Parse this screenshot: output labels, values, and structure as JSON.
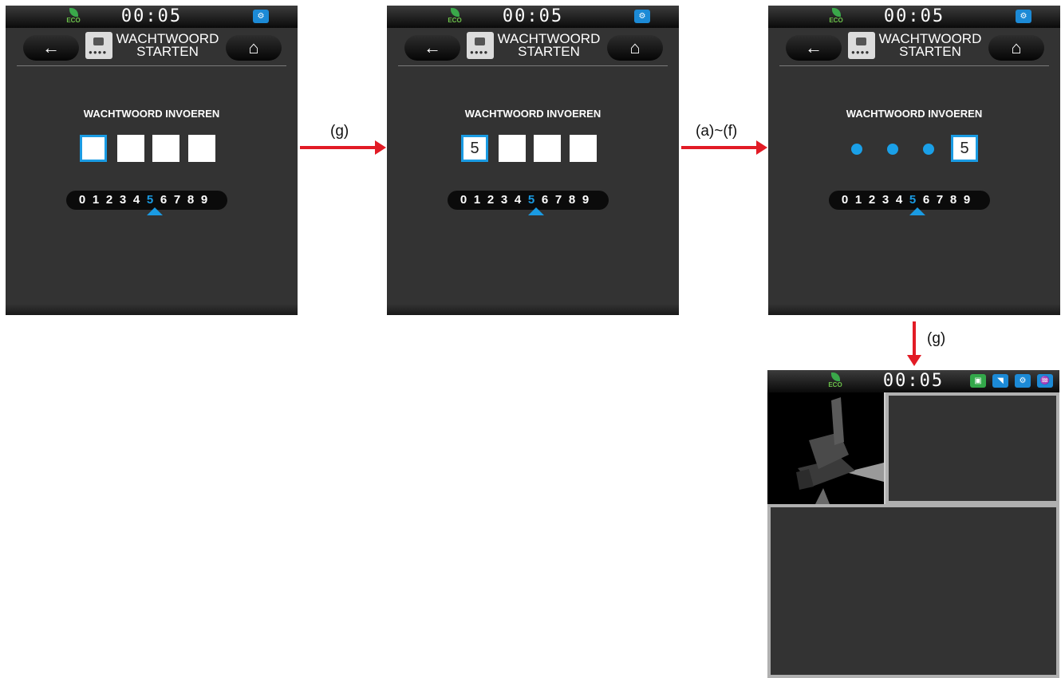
{
  "colors": {
    "accent": "#1a9be3",
    "screen_bg": "#333333",
    "arrow": "#e21b25",
    "eco": "#6cc24a"
  },
  "status_bar": {
    "eco_label": "ECO",
    "clock": "00:05"
  },
  "screens": [
    {
      "title_line1": "WACHTWOORD",
      "title_line2": "STARTEN",
      "prompt": "WACHTWOORD INVOEREN",
      "entry": [
        "",
        "",
        "",
        ""
      ],
      "digits": [
        "0",
        "1",
        "2",
        "3",
        "4",
        "5",
        "6",
        "7",
        "8",
        "9"
      ],
      "selected_digit": "5"
    },
    {
      "title_line1": "WACHTWOORD",
      "title_line2": "STARTEN",
      "prompt": "WACHTWOORD INVOEREN",
      "entry": [
        "5",
        "",
        "",
        ""
      ],
      "digits": [
        "0",
        "1",
        "2",
        "3",
        "4",
        "5",
        "6",
        "7",
        "8",
        "9"
      ],
      "selected_digit": "5"
    },
    {
      "title_line1": "WACHTWOORD",
      "title_line2": "STARTEN",
      "prompt": "WACHTWOORD INVOEREN",
      "entry": [
        "•",
        "•",
        "•",
        "5"
      ],
      "digits": [
        "0",
        "1",
        "2",
        "3",
        "4",
        "5",
        "6",
        "7",
        "8",
        "9"
      ],
      "selected_digit": "5"
    }
  ],
  "arrows": [
    {
      "label": "(g)"
    },
    {
      "label": "(a)~(f)"
    },
    {
      "label": "(g)"
    }
  ],
  "icons": {
    "back": "←",
    "home": "⌂",
    "lock": "lock-icon",
    "engine": "engine-icon",
    "status_icons": [
      "fuel-icon",
      "wiper-icon",
      "engine-icon",
      "washer-icon"
    ]
  },
  "main_screen": {
    "clock": "00:05",
    "eco_label": "ECO"
  }
}
